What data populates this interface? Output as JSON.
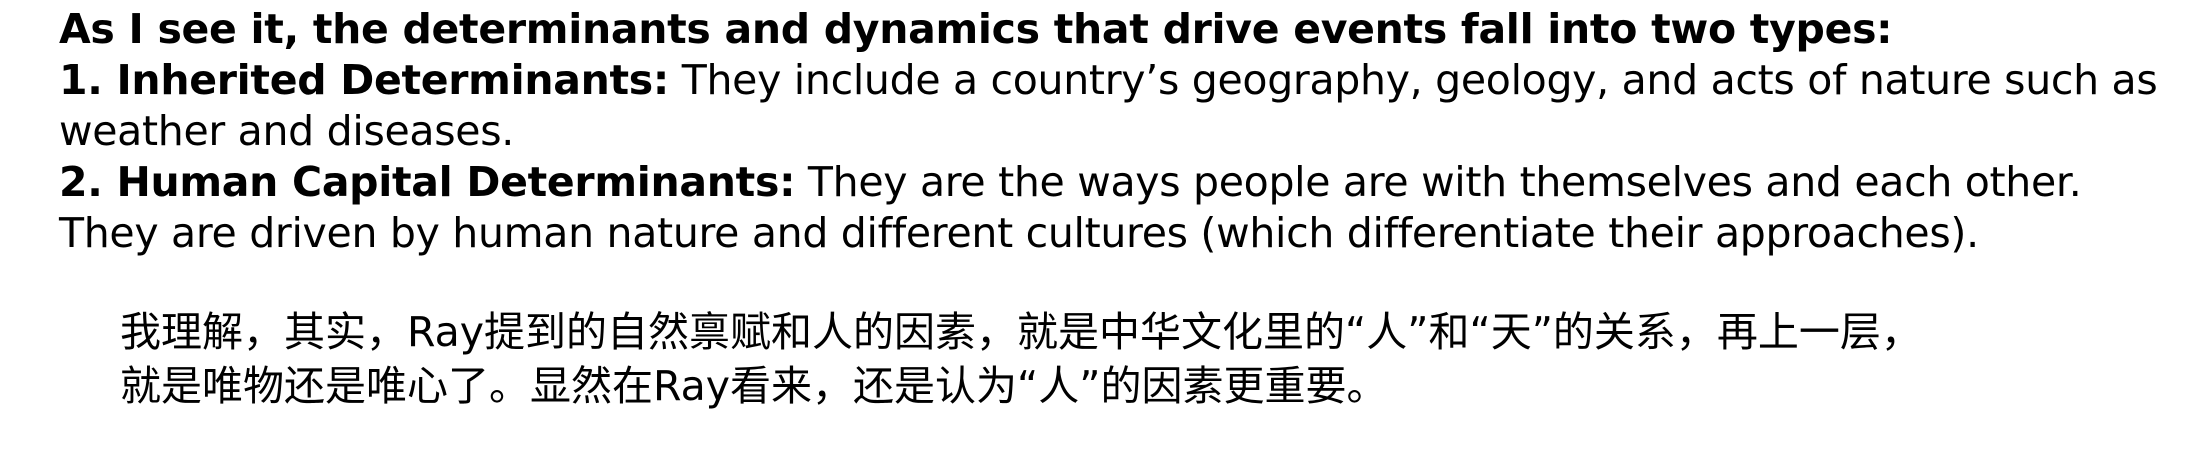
{
  "english": {
    "intro": "As I see it, the determinants and dynamics that drive events fall into two types:",
    "item1": {
      "term": "1. Inherited Determinants:",
      "text": " They include a country’s geography, geology, and acts of nature such as weather and diseases."
    },
    "item2": {
      "term": "2. Human Capital Determinants:",
      "text": " They are the ways people are with themselves and each other. They are driven by human nature and different cultures (which differentiate their approaches)."
    }
  },
  "chinese": {
    "line1": "我理解，其实，Ray提到的自然禀赋和人的因素，就是中华文化里的“人”和“天”的关系，再上一层，",
    "line2": "就是唯物还是唯心了。显然在Ray看来，还是认为“人”的因素更重要。"
  }
}
